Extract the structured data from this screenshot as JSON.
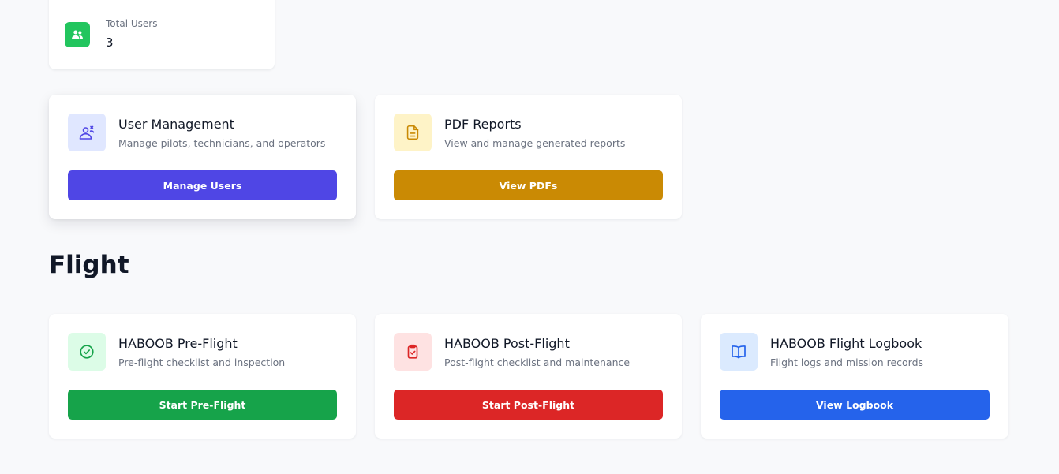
{
  "stats": {
    "total_users_label": "Total Users",
    "total_users_value": "3",
    "icon": "users-icon",
    "icon_color": "#22c55e"
  },
  "admin_cards": [
    {
      "title": "User Management",
      "description": "Manage pilots, technicians, and operators",
      "button": "Manage Users",
      "icon": "user-management-icon",
      "icon_bg": "#e0e7ff",
      "icon_color": "#4f46e5",
      "button_color": "#4f46e5"
    },
    {
      "title": "PDF Reports",
      "description": "View and manage generated reports",
      "button": "View PDFs",
      "icon": "document-icon",
      "icon_bg": "#fef3c7",
      "icon_color": "#ca8a04",
      "button_color": "#ca8a04"
    }
  ],
  "flight_section": {
    "title": "Flight",
    "cards": [
      {
        "title": "HABOOB Pre-Flight",
        "description": "Pre-flight checklist and inspection",
        "button": "Start Pre-Flight",
        "icon": "check-circle-icon",
        "icon_bg": "#dcfce7",
        "icon_color": "#16a34a",
        "button_color": "#16a34a"
      },
      {
        "title": "HABOOB Post-Flight",
        "description": "Post-flight checklist and maintenance",
        "button": "Start Post-Flight",
        "icon": "clipboard-check-icon",
        "icon_bg": "#fee2e2",
        "icon_color": "#dc2626",
        "button_color": "#dc2626"
      },
      {
        "title": "HABOOB Flight Logbook",
        "description": "Flight logs and mission records",
        "button": "View Logbook",
        "icon": "book-open-icon",
        "icon_bg": "#dbeafe",
        "icon_color": "#2563eb",
        "button_color": "#2563eb"
      }
    ]
  }
}
